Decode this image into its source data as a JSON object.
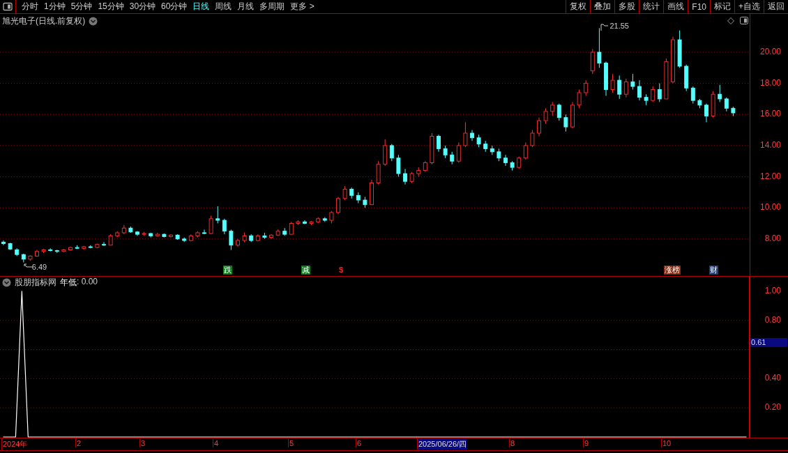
{
  "toolbar": {
    "periods": [
      {
        "label": "分时",
        "selected": false
      },
      {
        "label": "1分钟",
        "selected": false
      },
      {
        "label": "5分钟",
        "selected": false
      },
      {
        "label": "15分钟",
        "selected": false
      },
      {
        "label": "30分钟",
        "selected": false
      },
      {
        "label": "60分钟",
        "selected": false
      },
      {
        "label": "日线",
        "selected": true
      },
      {
        "label": "周线",
        "selected": false
      },
      {
        "label": "月线",
        "selected": false
      },
      {
        "label": "多周期",
        "selected": false
      },
      {
        "label": "更多 >",
        "selected": false
      }
    ],
    "buttons": [
      "复权",
      "叠加",
      "多股",
      "统计",
      "画线",
      "F10",
      "标记",
      "+自选",
      "返回"
    ]
  },
  "price_chart": {
    "title": "旭光电子(日线.前复权)",
    "high_label": "21.55",
    "low_label": "6.49",
    "chart_data": {
      "type": "candlestick",
      "ylim": [
        5.62,
        22.46
      ],
      "grid": true,
      "yticks": [
        {
          "value": 20,
          "label": "20.00"
        },
        {
          "value": 18,
          "label": "18.00"
        },
        {
          "value": 16,
          "label": "16.00"
        },
        {
          "value": 14,
          "label": "14.00"
        },
        {
          "value": 12,
          "label": "12.00"
        },
        {
          "value": 10,
          "label": "10.00"
        },
        {
          "value": 8,
          "label": "8.00"
        }
      ],
      "ohlc": [
        [
          7.8,
          7.9,
          7.6,
          7.7
        ],
        [
          7.7,
          7.75,
          7.3,
          7.35
        ],
        [
          7.3,
          7.4,
          6.9,
          7.0
        ],
        [
          7.0,
          7.05,
          6.49,
          6.7
        ],
        [
          6.7,
          6.95,
          6.6,
          6.9
        ],
        [
          6.9,
          7.3,
          6.85,
          7.2
        ],
        [
          7.2,
          7.35,
          7.1,
          7.3
        ],
        [
          7.3,
          7.4,
          7.2,
          7.25
        ],
        [
          7.25,
          7.3,
          7.1,
          7.2
        ],
        [
          7.2,
          7.35,
          7.15,
          7.3
        ],
        [
          7.3,
          7.5,
          7.25,
          7.45
        ],
        [
          7.45,
          7.6,
          7.35,
          7.4
        ],
        [
          7.4,
          7.55,
          7.3,
          7.5
        ],
        [
          7.5,
          7.6,
          7.4,
          7.45
        ],
        [
          7.45,
          7.7,
          7.4,
          7.65
        ],
        [
          7.65,
          7.8,
          7.55,
          7.6
        ],
        [
          7.6,
          8.3,
          7.6,
          8.2
        ],
        [
          8.2,
          8.5,
          8.1,
          8.4
        ],
        [
          8.4,
          8.9,
          8.3,
          8.7
        ],
        [
          8.7,
          8.8,
          8.4,
          8.45
        ],
        [
          8.45,
          8.5,
          8.2,
          8.3
        ],
        [
          8.3,
          8.45,
          8.2,
          8.35
        ],
        [
          8.35,
          8.4,
          8.1,
          8.2
        ],
        [
          8.2,
          8.4,
          8.15,
          8.3
        ],
        [
          8.3,
          8.35,
          8.1,
          8.15
        ],
        [
          8.15,
          8.3,
          8.1,
          8.25
        ],
        [
          8.25,
          8.3,
          7.95,
          8.0
        ],
        [
          8.0,
          8.1,
          7.8,
          7.9
        ],
        [
          7.9,
          8.3,
          7.85,
          8.2
        ],
        [
          8.2,
          8.5,
          8.1,
          8.4
        ],
        [
          8.4,
          8.6,
          8.3,
          8.35
        ],
        [
          8.35,
          9.5,
          8.3,
          9.3
        ],
        [
          9.3,
          10.1,
          9.0,
          9.2
        ],
        [
          9.2,
          9.3,
          8.3,
          8.5
        ],
        [
          8.5,
          8.6,
          7.3,
          7.6
        ],
        [
          7.6,
          8.0,
          7.5,
          7.9
        ],
        [
          7.9,
          8.4,
          7.8,
          8.2
        ],
        [
          8.2,
          8.3,
          7.8,
          7.9
        ],
        [
          7.9,
          8.3,
          7.85,
          8.2
        ],
        [
          8.2,
          8.4,
          8.0,
          8.1
        ],
        [
          8.1,
          8.3,
          8.0,
          8.25
        ],
        [
          8.25,
          8.6,
          8.2,
          8.5
        ],
        [
          8.5,
          8.7,
          8.2,
          8.3
        ],
        [
          8.3,
          9.1,
          8.3,
          9.0
        ],
        [
          9.0,
          9.2,
          8.9,
          9.1
        ],
        [
          9.1,
          9.2,
          8.95,
          9.0
        ],
        [
          9.0,
          9.15,
          8.9,
          9.1
        ],
        [
          9.1,
          9.4,
          9.0,
          9.3
        ],
        [
          9.3,
          9.4,
          9.1,
          9.2
        ],
        [
          9.2,
          9.8,
          9.0,
          9.7
        ],
        [
          9.7,
          10.7,
          9.6,
          10.6
        ],
        [
          10.6,
          11.4,
          10.5,
          11.2
        ],
        [
          11.2,
          11.3,
          10.6,
          10.8
        ],
        [
          10.8,
          11.0,
          10.3,
          10.5
        ],
        [
          10.5,
          10.7,
          10.0,
          10.2
        ],
        [
          10.2,
          11.8,
          10.2,
          11.6
        ],
        [
          11.6,
          13.0,
          11.5,
          12.8
        ],
        [
          12.8,
          14.4,
          12.7,
          14.0
        ],
        [
          14.0,
          14.1,
          13.0,
          13.2
        ],
        [
          13.2,
          13.4,
          12.0,
          12.2
        ],
        [
          12.2,
          12.5,
          11.5,
          11.7
        ],
        [
          11.7,
          12.3,
          11.6,
          12.2
        ],
        [
          12.2,
          12.6,
          12.0,
          12.4
        ],
        [
          12.4,
          13.0,
          12.3,
          12.9
        ],
        [
          12.9,
          14.8,
          12.8,
          14.6
        ],
        [
          14.6,
          14.7,
          13.6,
          13.8
        ],
        [
          13.8,
          14.0,
          13.2,
          13.4
        ],
        [
          13.4,
          13.6,
          12.8,
          13.0
        ],
        [
          13.0,
          14.2,
          12.9,
          14.0
        ],
        [
          14.0,
          15.5,
          13.9,
          14.8
        ],
        [
          14.8,
          15.0,
          14.3,
          14.5
        ],
        [
          14.5,
          14.7,
          13.9,
          14.1
        ],
        [
          14.1,
          14.3,
          13.6,
          13.8
        ],
        [
          13.8,
          14.0,
          13.4,
          13.6
        ],
        [
          13.6,
          13.8,
          13.0,
          13.2
        ],
        [
          13.2,
          13.4,
          12.7,
          12.9
        ],
        [
          12.9,
          13.0,
          12.4,
          12.6
        ],
        [
          12.6,
          13.3,
          12.5,
          13.2
        ],
        [
          13.2,
          14.2,
          13.1,
          14.0
        ],
        [
          14.0,
          15.0,
          13.9,
          14.8
        ],
        [
          14.8,
          15.8,
          14.6,
          15.6
        ],
        [
          15.6,
          16.4,
          15.4,
          16.2
        ],
        [
          16.2,
          16.8,
          15.9,
          16.6
        ],
        [
          16.6,
          16.7,
          15.6,
          15.8
        ],
        [
          15.8,
          16.0,
          14.9,
          15.2
        ],
        [
          15.2,
          16.8,
          15.1,
          16.6
        ],
        [
          16.6,
          17.6,
          16.4,
          17.4
        ],
        [
          17.4,
          18.2,
          17.2,
          18.0
        ],
        [
          18.8,
          20.2,
          18.6,
          20.0
        ],
        [
          20.0,
          21.55,
          19.0,
          19.3
        ],
        [
          19.3,
          19.4,
          17.2,
          17.6
        ],
        [
          17.6,
          18.6,
          17.4,
          18.2
        ],
        [
          18.2,
          18.5,
          17.0,
          17.3
        ],
        [
          17.3,
          18.3,
          17.1,
          18.1
        ],
        [
          18.1,
          18.6,
          17.6,
          17.8
        ],
        [
          17.8,
          18.2,
          16.9,
          17.1
        ],
        [
          17.1,
          17.3,
          16.6,
          16.9
        ],
        [
          16.9,
          17.8,
          16.8,
          17.6
        ],
        [
          17.6,
          18.0,
          16.8,
          17.0
        ],
        [
          17.0,
          19.6,
          17.0,
          19.4
        ],
        [
          18.1,
          21.0,
          18.0,
          20.8
        ],
        [
          20.8,
          21.4,
          19.0,
          19.1
        ],
        [
          19.1,
          19.2,
          17.5,
          17.7
        ],
        [
          17.7,
          17.8,
          16.7,
          16.9
        ],
        [
          16.9,
          17.0,
          16.4,
          16.6
        ],
        [
          16.6,
          16.7,
          15.5,
          15.9
        ],
        [
          15.9,
          17.5,
          15.8,
          17.3
        ],
        [
          17.3,
          17.9,
          16.8,
          17.0
        ],
        [
          17.0,
          17.1,
          16.2,
          16.4
        ],
        [
          16.4,
          16.5,
          15.9,
          16.1
        ]
      ]
    },
    "markers": [
      {
        "label": "跌",
        "kind": "badge",
        "color": "#0b7d1a"
      },
      {
        "label": "减",
        "kind": "badge",
        "color": "#0b7d1a"
      },
      {
        "label": "$",
        "kind": "glyph",
        "color": "#ff2020"
      },
      {
        "label": "涨榜",
        "kind": "badge",
        "color": "#8a2a10"
      },
      {
        "label": "财",
        "kind": "badge",
        "color": "#1c3f80"
      }
    ]
  },
  "indicator": {
    "title": "股朋指标网",
    "reading": ": 0.00",
    "current": "0.61",
    "chart_data": {
      "type": "line",
      "grid": true,
      "categories": [
        null,
        null,
        null,
        null,
        null,
        null,
        null,
        null,
        null,
        null,
        null,
        null,
        null,
        null,
        null,
        null,
        null,
        null,
        null,
        null,
        null,
        null,
        null,
        null,
        null,
        null,
        null,
        null,
        null,
        null,
        null,
        null,
        null,
        null,
        null,
        null,
        null,
        null,
        null,
        null,
        null,
        null,
        null,
        null,
        null,
        null,
        null,
        null,
        null,
        null,
        null,
        null,
        null,
        null,
        null,
        null,
        null,
        null,
        null,
        null,
        null,
        null,
        null,
        null,
        null,
        null,
        null,
        null,
        null,
        null,
        null,
        null,
        null,
        null,
        null,
        null,
        null,
        null,
        null,
        null,
        null,
        null,
        null,
        null,
        null,
        null,
        null,
        null,
        null,
        null,
        null,
        null,
        null,
        null,
        null,
        null,
        null,
        null,
        null,
        null,
        null,
        null,
        null,
        null,
        null,
        null,
        null,
        null,
        null,
        null,
        null,
        null,
        null,
        null,
        null,
        null,
        null,
        null,
        null,
        null
      ],
      "series": [
        {
          "name": "年低",
          "color": "#ffffff",
          "values": [
            0,
            0,
            0,
            1,
            0,
            0,
            0,
            0,
            0,
            0,
            0,
            0,
            0,
            0,
            0,
            0,
            0,
            0,
            0,
            0,
            0,
            0,
            0,
            0,
            0,
            0,
            0,
            0,
            0,
            0,
            0,
            0,
            0,
            0,
            0,
            0,
            0,
            0,
            0,
            0,
            0,
            0,
            0,
            0,
            0,
            0,
            0,
            0,
            0,
            0,
            0,
            0,
            0,
            0,
            0,
            0,
            0,
            0,
            0,
            0,
            0,
            0,
            0,
            0,
            0,
            0,
            0,
            0,
            0,
            0,
            0,
            0,
            0,
            0,
            0,
            0,
            0,
            0,
            0,
            0,
            0,
            0,
            0,
            0,
            0,
            0,
            0,
            0,
            0,
            0,
            0,
            0,
            0,
            0,
            0,
            0,
            0,
            0,
            0,
            0,
            0,
            0,
            0,
            0,
            0,
            0,
            0,
            0,
            0,
            0,
            0,
            0,
            0,
            0,
            0,
            0,
            0,
            0,
            0,
            0
          ]
        }
      ],
      "ylim": [
        0,
        1.1
      ],
      "yticks": [
        {
          "value": 1,
          "label": "1.00"
        },
        {
          "value": 0.8,
          "label": "0.80"
        },
        {
          "value": 0.4,
          "label": "0.40"
        },
        {
          "value": 0.2,
          "label": "0.20"
        }
      ]
    }
  },
  "x_axis": [
    {
      "label": "2024年",
      "selected": false
    },
    {
      "label": "2",
      "selected": false
    },
    {
      "label": "3",
      "selected": false
    },
    {
      "label": "4",
      "selected": false
    },
    {
      "label": "5",
      "selected": false
    },
    {
      "label": "6",
      "selected": false
    },
    {
      "label": "2025/06/26/四",
      "selected": true
    },
    {
      "label": "8",
      "selected": false
    },
    {
      "label": "9",
      "selected": false
    },
    {
      "label": "10",
      "selected": false
    }
  ]
}
